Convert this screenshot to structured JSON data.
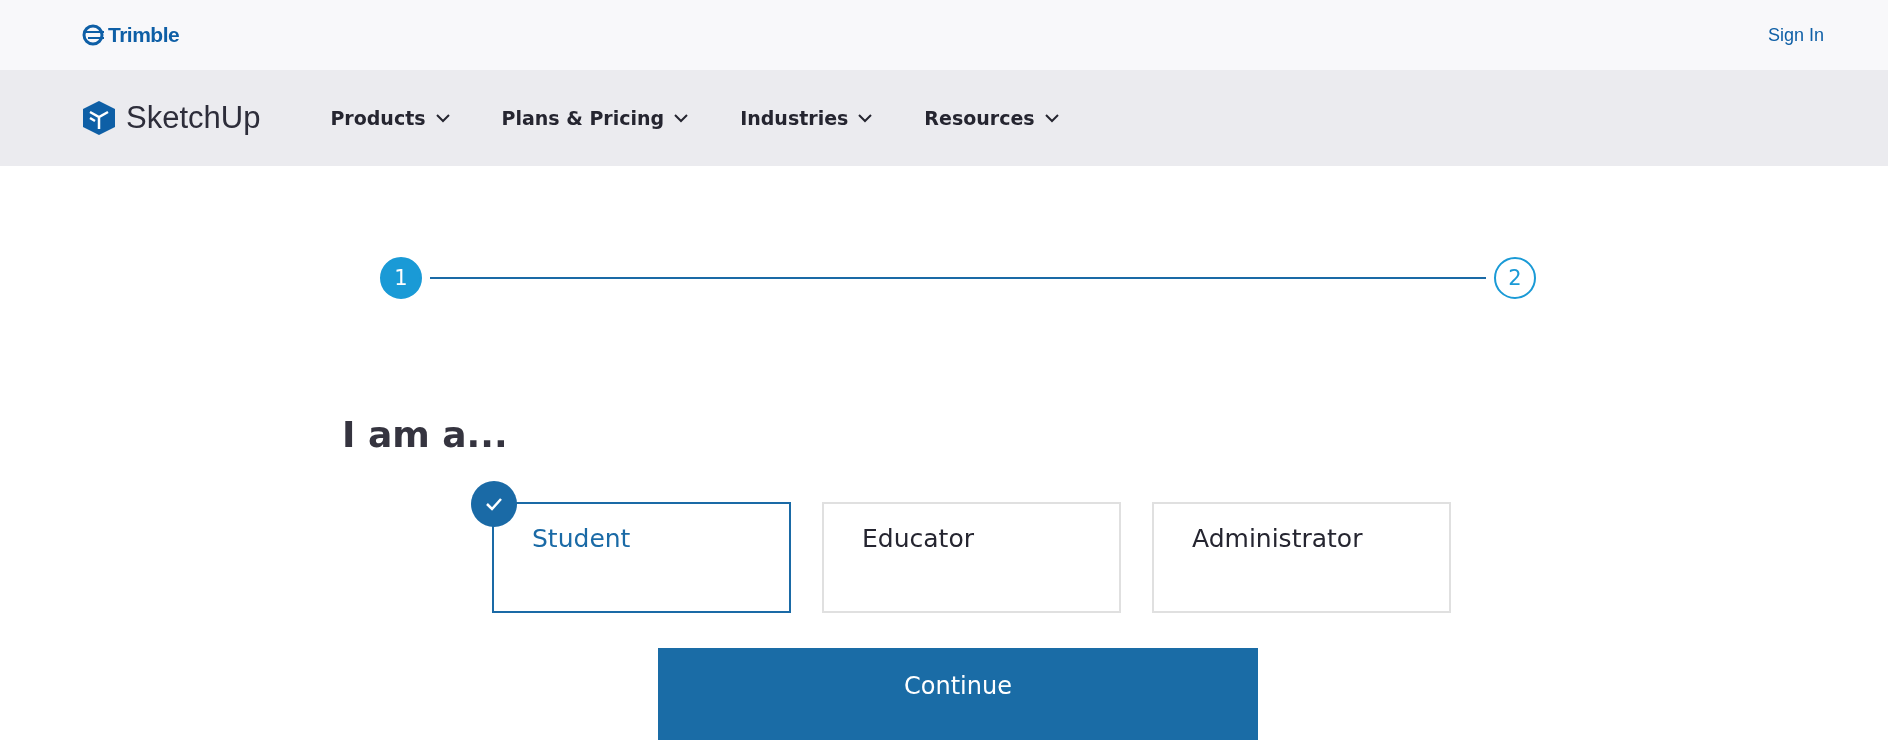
{
  "top_bar": {
    "brand": "Trimble",
    "sign_in": "Sign In"
  },
  "nav": {
    "logo": "SketchUp",
    "items": [
      {
        "label": "Products"
      },
      {
        "label": "Plans & Pricing"
      },
      {
        "label": "Industries"
      },
      {
        "label": "Resources"
      }
    ]
  },
  "stepper": [
    {
      "label": "1",
      "selected": true
    },
    {
      "label": "2",
      "selected": false
    }
  ],
  "heading": "I am a...",
  "roles": [
    {
      "label": "Student",
      "selected": true
    },
    {
      "label": "Educator",
      "selected": false
    },
    {
      "label": "Administrator",
      "selected": false
    }
  ],
  "continue_button": "Continue"
}
